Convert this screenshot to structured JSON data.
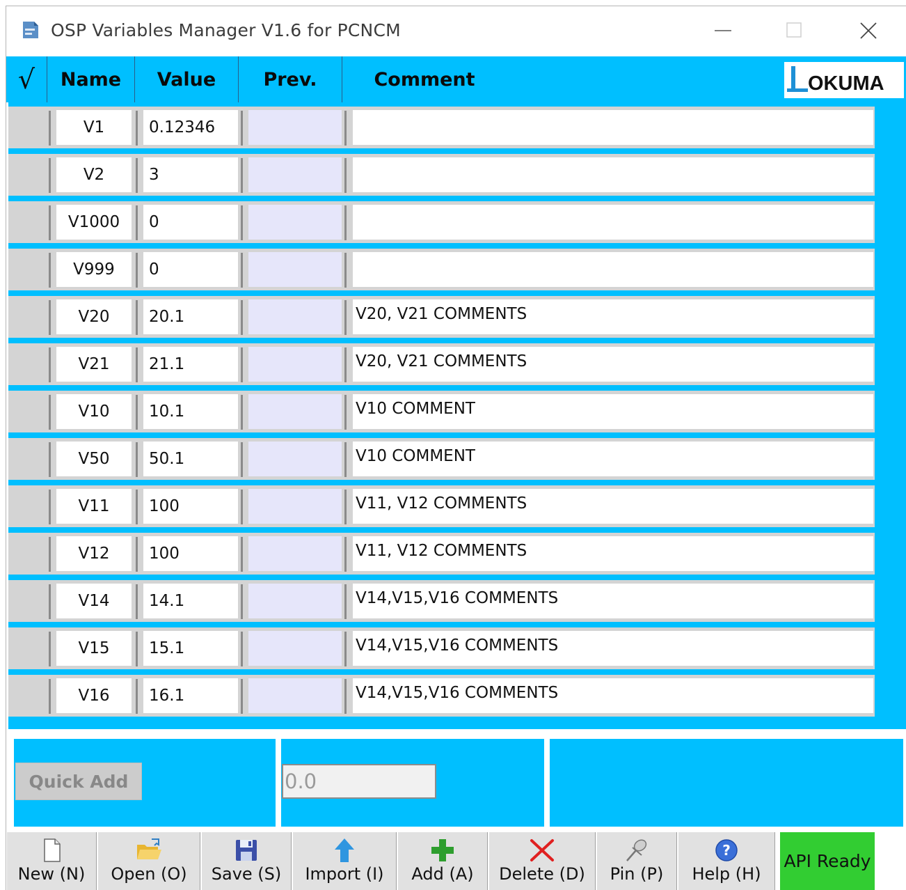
{
  "window": {
    "title": "OSP Variables Manager V1.6 for PCNCM"
  },
  "header": {
    "check_glyph": "√",
    "columns": [
      "Name",
      "Value",
      "Prev.",
      "Comment"
    ],
    "logo_text": "OKUMA"
  },
  "rows": [
    {
      "name": "V1",
      "value": "0.12346",
      "prev": "",
      "comment": ""
    },
    {
      "name": "V2",
      "value": "3",
      "prev": "",
      "comment": ""
    },
    {
      "name": "V1000",
      "value": "0",
      "prev": "",
      "comment": ""
    },
    {
      "name": "V999",
      "value": "0",
      "prev": "",
      "comment": ""
    },
    {
      "name": "V20",
      "value": "20.1",
      "prev": "",
      "comment": "V20, V21 COMMENTS"
    },
    {
      "name": "V21",
      "value": "21.1",
      "prev": "",
      "comment": "V20, V21 COMMENTS"
    },
    {
      "name": "V10",
      "value": "10.1",
      "prev": "",
      "comment": "V10 COMMENT"
    },
    {
      "name": "V50",
      "value": "50.1",
      "prev": "",
      "comment": "V10 COMMENT"
    },
    {
      "name": "V11",
      "value": "100",
      "prev": "",
      "comment": "V11, V12 COMMENTS"
    },
    {
      "name": "V12",
      "value": "100",
      "prev": "",
      "comment": "V11, V12 COMMENTS"
    },
    {
      "name": "V14",
      "value": "14.1",
      "prev": "",
      "comment": "V14,V15,V16 COMMENTS"
    },
    {
      "name": "V15",
      "value": "15.1",
      "prev": "",
      "comment": "V14,V15,V16 COMMENTS"
    },
    {
      "name": "V16",
      "value": "16.1",
      "prev": "",
      "comment": "V14,V15,V16 COMMENTS"
    }
  ],
  "quick_add": {
    "button_label": "Quick Add",
    "value": "0.0"
  },
  "toolbar": {
    "buttons": [
      {
        "label": "New (N)",
        "icon": "new-file-icon"
      },
      {
        "label": "Open (O)",
        "icon": "open-folder-icon"
      },
      {
        "label": "Save (S)",
        "icon": "save-disk-icon"
      },
      {
        "label": "Import (I)",
        "icon": "import-arrow-icon"
      },
      {
        "label": "Add (A)",
        "icon": "add-plus-icon"
      },
      {
        "label": "Delete (D)",
        "icon": "delete-x-icon"
      },
      {
        "label": "Pin (P)",
        "icon": "pin-icon"
      },
      {
        "label": "Help (H)",
        "icon": "help-icon"
      }
    ],
    "status": "API Ready"
  },
  "colors": {
    "accent": "#00bfff",
    "status_ok": "#32cd32",
    "prev_cell": "#e6e6fa"
  }
}
